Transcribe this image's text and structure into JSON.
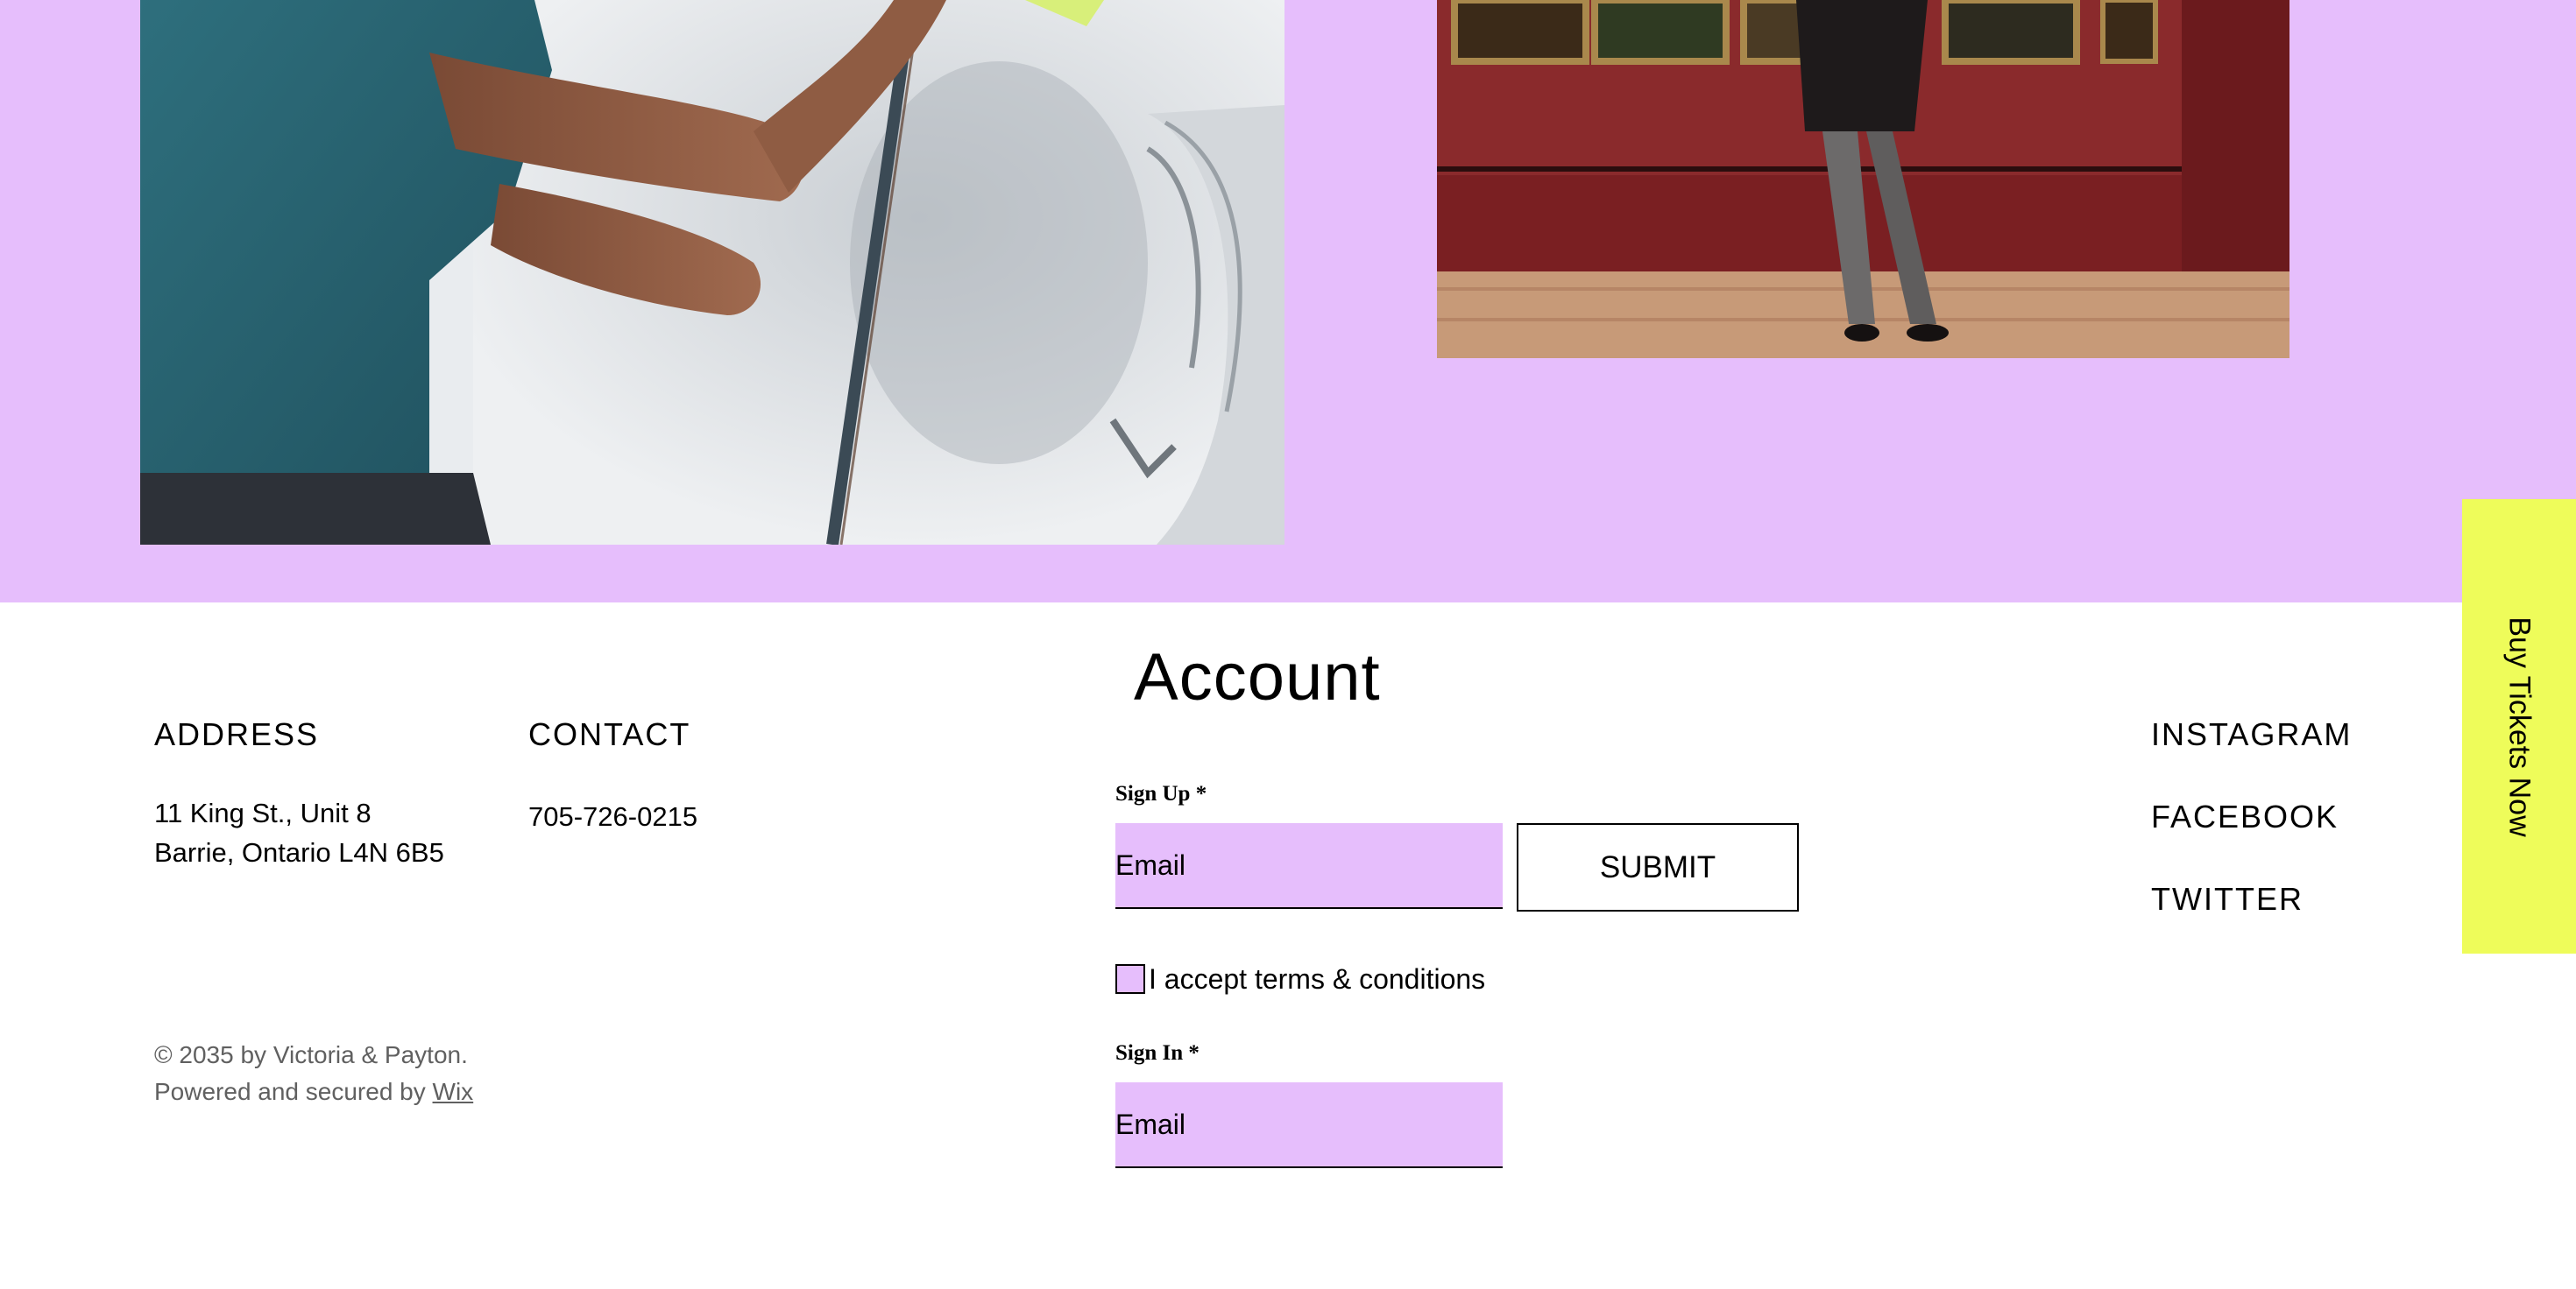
{
  "colors": {
    "band": "#e6befc",
    "field": "#e6befc",
    "tab": "#eefc5a",
    "muted": "#606060"
  },
  "footer": {
    "address": {
      "heading": "ADDRESS",
      "lines": "11 King St., Unit 8\nBarrie, Ontario  L4N 6B5"
    },
    "contact": {
      "heading": "CONTACT",
      "phone": "705-726-0215"
    },
    "copyright": {
      "text": "© 2035 by Victoria & Payton.",
      "powered": "Powered and secured by ",
      "link": "Wix"
    },
    "social": [
      "INSTAGRAM",
      "FACEBOOK",
      "TWITTER"
    ]
  },
  "account": {
    "title": "Account",
    "signup_label": "Sign Up *",
    "signup_placeholder": "Email",
    "submit_label": "SUBMIT",
    "terms_label": "I accept terms & conditions",
    "signin_label": "Sign In *",
    "signin_placeholder": "Email"
  },
  "side_tab": {
    "label": "Buy Tickets Now"
  }
}
